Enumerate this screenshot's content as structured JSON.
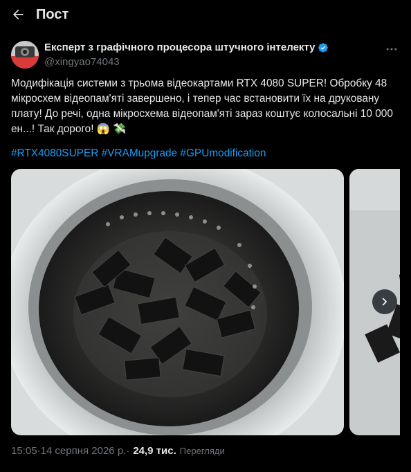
{
  "header": {
    "title": "Пост"
  },
  "author": {
    "name": "Експерт з графічного процесора штучного інтелекту",
    "handle": "@xingyao74043"
  },
  "post": {
    "text": "Модифікація системи з трьома відеокартами RTX 4080 SUPER! Обробку 48 мікросхем відеопам'яті завершено, і тепер час встановити їх на друковану плату! До речі, одна мікросхема відеопам'яті зараз коштує колосальні 10 000 ен...! Так дорого! 😱 💸",
    "hashtags": [
      "#RTX4080SUPER",
      "#VRAMupgrade",
      "#GPUmodification"
    ]
  },
  "meta": {
    "time": "15:05",
    "separator": " · ",
    "date": "14 серпня 2026 р.",
    "views_count": "24,9 тис.",
    "views_label": "Перегляди"
  },
  "colors": {
    "accent": "#1d9bf0",
    "muted": "#71767b",
    "text": "#e7e9ea",
    "background": "#000000"
  },
  "icons": [
    "back-arrow-icon",
    "verified-badge-icon",
    "more-options-icon",
    "chevron-right-icon"
  ]
}
